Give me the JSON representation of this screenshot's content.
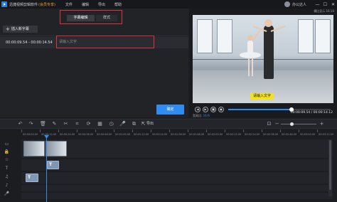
{
  "app": {
    "title": "迅捷视频剪辑软件",
    "edition": "(会员专享)",
    "menu": [
      "文件",
      "编辑",
      "导出",
      "帮助"
    ],
    "user_name": "办公达人",
    "window_controls": [
      "—",
      "☐",
      "✕"
    ]
  },
  "subtitle_editor": {
    "tabs": [
      "字幕编辑",
      "样式"
    ],
    "add_button": "插入新字幕",
    "entries": [
      {
        "time_range": "00:00:09.54 - 00:00:14.54",
        "placeholder": "请输入文字"
      }
    ],
    "confirm_button": "确定"
  },
  "preview": {
    "ratio_label": "横比显示 16:10",
    "caption": "请输入文字",
    "progress": 0.62,
    "info_label": "宽高比:",
    "info_value": "16:9",
    "time_display": "00:00:09.54 / 00:00:14.12",
    "controls": [
      "◀",
      "▶",
      "■",
      "●"
    ]
  },
  "toolbar": {
    "export_label": "导出",
    "zoom_level": 0.3
  },
  "timeline": {
    "ruler_labels": [
      "00:00:00.00",
      "00:00:12.00",
      "00:00:24.00",
      "00:00:36.00",
      "00:00:48.00",
      "00:01:00.00",
      "00:01:12.00",
      "00:01:24.00",
      "00:01:36.00",
      "00:01:48.00",
      "00:02:00.00",
      "00:02:12.00",
      "00:02:24.00",
      "00:02:36.00",
      "00:02:48.00",
      "00:03:00.00",
      "00:03:12.00"
    ],
    "text_clip_glyph": "T"
  },
  "colors": {
    "accent": "#2f8cf0",
    "highlight_frame": "#e0323a",
    "caption_bg": "#f5e11e"
  }
}
